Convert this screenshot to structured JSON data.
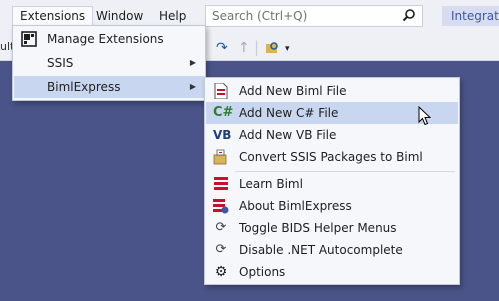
{
  "menubar": {
    "extensions": "Extensions",
    "window": "Window",
    "help": "Help"
  },
  "search": {
    "placeholder": "Search (Ctrl+Q)"
  },
  "integrate": {
    "label": "Integration"
  },
  "toolbar": {
    "cut_label": "ult"
  },
  "ext_menu": {
    "items": [
      {
        "label": "Manage Extensions",
        "icon": "extensions-icon"
      },
      {
        "label": "SSIS",
        "icon": ""
      },
      {
        "label": "BimlExpress",
        "icon": ""
      }
    ]
  },
  "biml_menu": {
    "items": [
      {
        "label": "Add New Biml File",
        "icon": "biml-file-icon"
      },
      {
        "label": "Add New C# File",
        "icon": "csharp-icon",
        "glyph": "C#"
      },
      {
        "label": "Add New VB File",
        "icon": "vb-icon",
        "glyph": "VB"
      },
      {
        "label": "Convert SSIS Packages to Biml",
        "icon": "convert-icon"
      },
      {
        "label": "Learn Biml",
        "icon": "learn-icon"
      },
      {
        "label": "About BimlExpress",
        "icon": "about-icon"
      },
      {
        "label": "Toggle BIDS Helper Menus",
        "icon": "refresh-icon"
      },
      {
        "label": "Disable .NET Autocomplete",
        "icon": "refresh-icon"
      },
      {
        "label": "Options",
        "icon": "gear-icon"
      }
    ]
  },
  "colors": {
    "background": "#4a5488",
    "highlight": "#c9d6f0",
    "accent": "#3f56a8"
  }
}
